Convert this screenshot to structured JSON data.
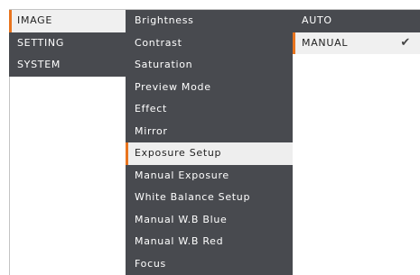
{
  "menu": {
    "categories": [
      {
        "label": "IMAGE"
      },
      {
        "label": "SETTING"
      },
      {
        "label": "SYSTEM"
      }
    ],
    "submenu": [
      {
        "label": "Brightness"
      },
      {
        "label": "Contrast"
      },
      {
        "label": "Saturation"
      },
      {
        "label": "Preview Mode"
      },
      {
        "label": "Effect"
      },
      {
        "label": "Mirror"
      },
      {
        "label": "Exposure Setup"
      },
      {
        "label": "Manual Exposure"
      },
      {
        "label": "White Balance Setup"
      },
      {
        "label": "Manual W.B Blue"
      },
      {
        "label": "Manual W.B Red"
      },
      {
        "label": "Focus"
      }
    ],
    "options": [
      {
        "label": "AUTO"
      },
      {
        "label": "MANUAL",
        "check": "✔"
      }
    ]
  },
  "colors": {
    "menu_bg": "#484a4f",
    "highlight_bg": "#f0f0f0",
    "accent": "#e8741e"
  },
  "icons": {
    "selected_option": "checkmark-icon"
  }
}
